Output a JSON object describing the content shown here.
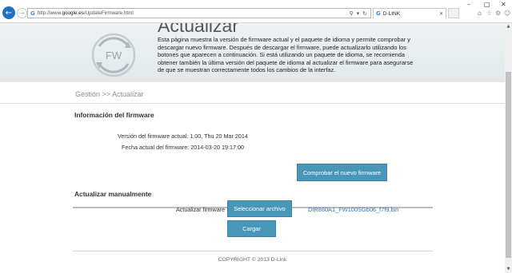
{
  "browser": {
    "url_prefix": "http://www.",
    "url_domain": "google.es",
    "url_path": "/UpdateFirmware.html",
    "tab_title": "D-LINK",
    "google_icon": "G"
  },
  "page": {
    "logo_text": "FW",
    "title": "Actualizar",
    "description": "Esta página muestra la versión de firmware actual y el paquete de idioma y permite comprobar y descargar nuevo firmware. Después de descargar el firmware, puede actualizarlo utilizando los botones que aparecen a continuación. Si está utilizando un paquete de idioma, se recomienda obtener también la última versión del paquete de idioma al actualizar el firmware para asegurarse de que se muestran correctamente todos los cambios de la interfaz.",
    "breadcrumb": "Gestión >> Actualizar"
  },
  "firmware_info": {
    "section_title": "Información del firmware",
    "version_line": "Versión del firmware actual: 1.00, Thu 20 Mar 2014",
    "date_line": "Fecha actual del firmware: 2014-03-20 19:17:00",
    "check_button": "Comprobar el nuevo firmware"
  },
  "manual_update": {
    "section_title": "Actualizar manualmente",
    "label": "Actualizar firmware",
    "select_button": "Seleccionar archivo",
    "file_name": "DIR880A1_FW100SGb06_f7f9.bin",
    "upload_button": "Cargar"
  },
  "footer": {
    "copyright": "COPYRIGHT © 2013 D-Link"
  },
  "colors": {
    "accent_button": "#4896b8",
    "link": "#2d79b5",
    "back_button": "#1f6fc5"
  },
  "icons": [
    "back-arrow-icon",
    "forward-arrow-icon",
    "google-icon",
    "search-icon",
    "refresh-icon",
    "close-icon",
    "home-icon",
    "star-icon",
    "gear-icon",
    "smiley-icon",
    "fw-refresh-logo"
  ]
}
